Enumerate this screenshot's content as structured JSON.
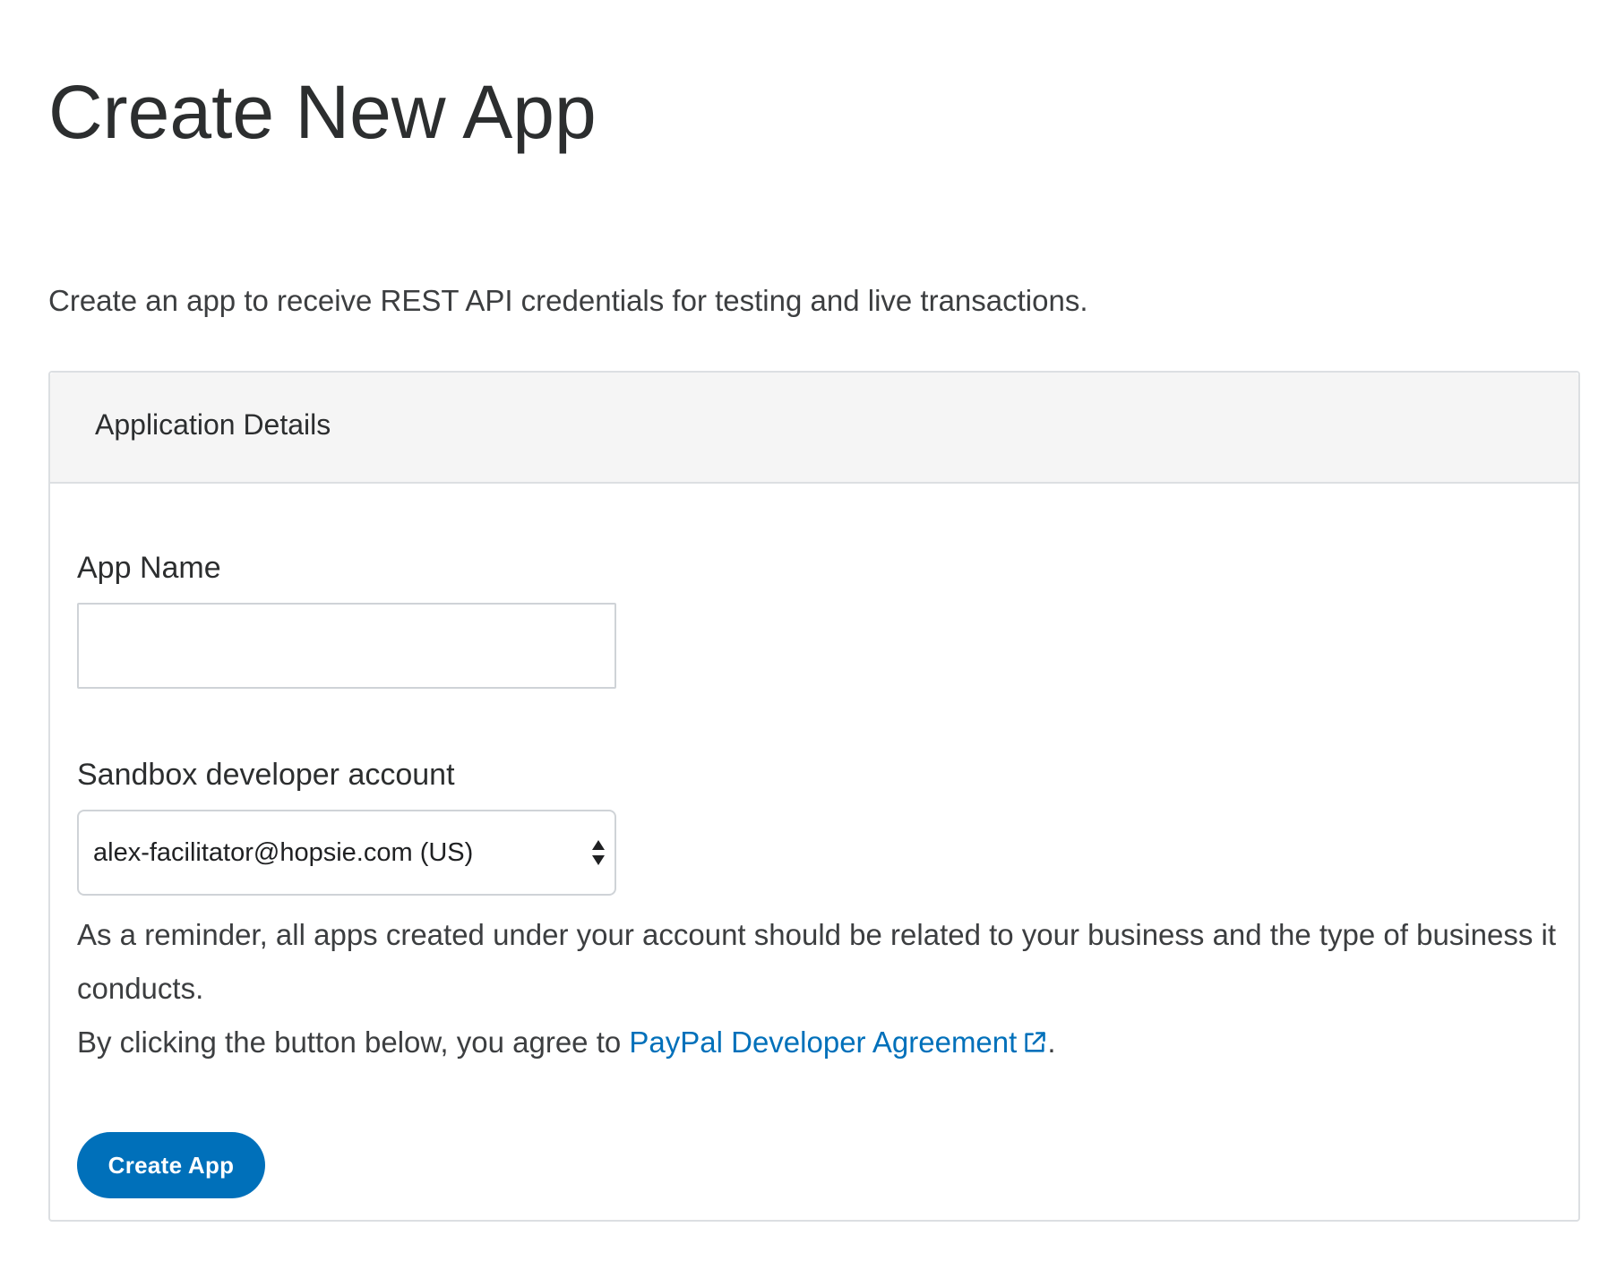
{
  "page": {
    "title": "Create New App",
    "intro": "Create an app to receive REST API credentials for testing and live transactions."
  },
  "panel": {
    "title": "Application Details",
    "app_name": {
      "label": "App Name",
      "value": "",
      "placeholder": ""
    },
    "sandbox_account": {
      "label": "Sandbox developer account",
      "selected": "alex-facilitator@hopsie.com (US)",
      "icon": "select-arrows-icon"
    },
    "reminder": "As a reminder, all apps created under your account should be related to your business and the type of business it conducts.",
    "agreement": {
      "prefix": "By clicking the button below, you agree to ",
      "link_text": "PayPal Developer Agreement",
      "suffix": ".",
      "icon": "external-link-icon"
    },
    "create_button_label": "Create App"
  },
  "colors": {
    "accent": "#0070ba",
    "header_bg": "#f5f5f5",
    "border": "#dcdfe2",
    "text": "#2c2e2f"
  }
}
